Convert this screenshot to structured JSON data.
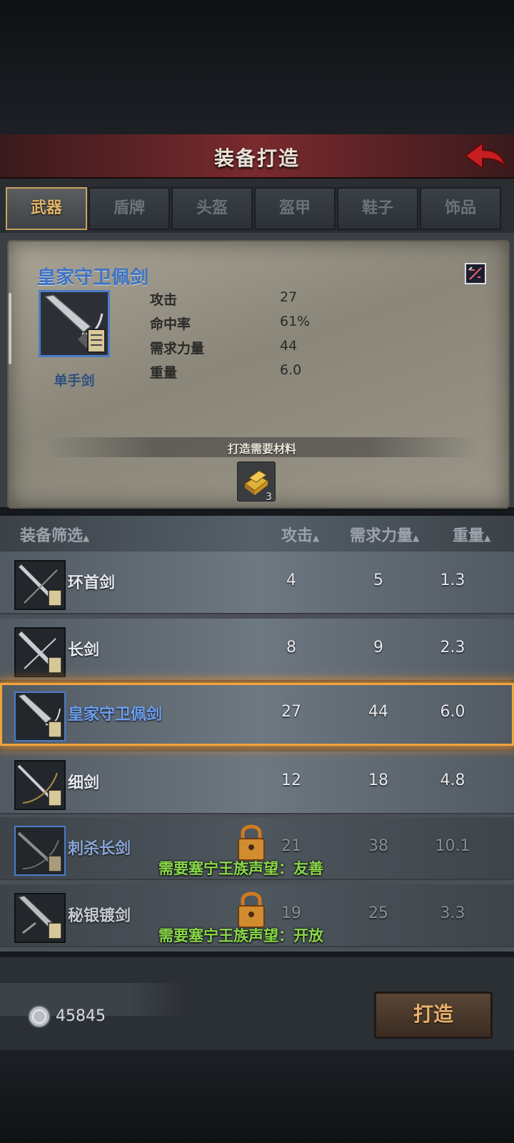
{
  "header": {
    "title": "装备打造"
  },
  "tabs": [
    {
      "label": "武器",
      "active": true
    },
    {
      "label": "盾牌",
      "active": false
    },
    {
      "label": "头盔",
      "active": false
    },
    {
      "label": "盔甲",
      "active": false
    },
    {
      "label": "鞋子",
      "active": false
    },
    {
      "label": "饰品",
      "active": false
    }
  ],
  "detail": {
    "name": "皇家守卫佩剑",
    "type": "单手剑",
    "stats": [
      {
        "label": "攻击",
        "value": "27"
      },
      {
        "label": "命中率",
        "value": "61%"
      },
      {
        "label": "需求力量",
        "value": "44"
      },
      {
        "label": "重量",
        "value": "6.0"
      }
    ],
    "materials_label": "打造需要材料",
    "material_count": "3"
  },
  "list_header": {
    "filter": "装备筛选",
    "attack": "攻击",
    "strength": "需求力量",
    "weight": "重量"
  },
  "items": [
    {
      "name": "环首剑",
      "attack": "4",
      "strength": "5",
      "weight": "1.3"
    },
    {
      "name": "长剑",
      "attack": "8",
      "strength": "9",
      "weight": "2.3"
    },
    {
      "name": "皇家守卫佩剑",
      "attack": "27",
      "strength": "44",
      "weight": "6.0",
      "selected": true
    },
    {
      "name": "细剑",
      "attack": "12",
      "strength": "18",
      "weight": "4.8"
    },
    {
      "name": "刺杀长剑",
      "attack": "21",
      "strength": "38",
      "weight": "10.1",
      "locked": true,
      "requirement": "需要塞宁王族声望：友善"
    },
    {
      "name": "秘银镀剑",
      "attack": "19",
      "strength": "25",
      "weight": "3.3",
      "locked": true,
      "requirement": "需要塞宁王族声望：开放"
    }
  ],
  "footer": {
    "coins": "45845",
    "forge_label": "打造"
  },
  "colors": {
    "accent": "#e2b36a",
    "selection": "#f2a43a",
    "rare_name": "#3c72c8",
    "requirement": "#8ad84a"
  }
}
